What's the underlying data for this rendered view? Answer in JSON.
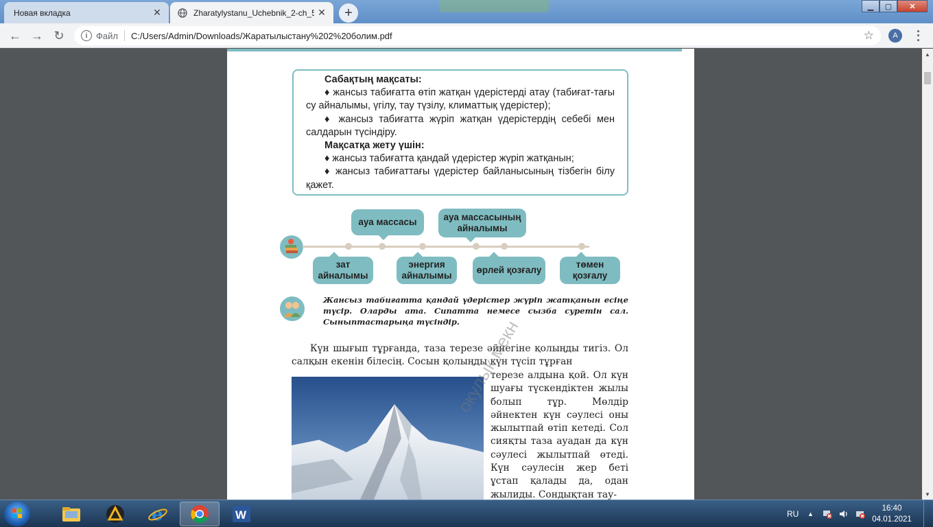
{
  "browser": {
    "tabs": [
      {
        "title": "Новая вкладка",
        "active": false
      },
      {
        "title": "Zharatylystanu_Uchebnik_2-ch_5",
        "active": true
      }
    ],
    "address": {
      "scheme_label": "Файл",
      "url": "C:/Users/Admin/Downloads/Жаратылыстану%202%20болим.pdf"
    },
    "profile_initial": "A"
  },
  "page": {
    "goal_box": {
      "heading1": "Сабақтың мақсаты:",
      "item1": "♦ жансыз табиғатта өтіп жатқан үдерістерді атау (табиғат-тағы су айналымы, үгілу, тау түзілу, климаттық үдерістер);",
      "item2": "♦ жансыз табиғатта жүріп жатқан үдерістердің себебі мен салдарын түсіндіру.",
      "heading2": "Мақсатқа жету үшін:",
      "item3": "♦ жансыз табиғатта қандай үдерістер жүріп жатқанын;",
      "item4": "♦ жансыз табиғаттағы үдерістер байланысының тізбегін білу қажет."
    },
    "timeline": {
      "above": [
        "ауа массасы",
        "ауа массасының айналымы"
      ],
      "below": [
        "зат айналымы",
        "энергия айналымы",
        "өрлей қозғалу",
        "төмен қозғалу"
      ]
    },
    "task": "Жансыз табиғатта қандай үдерістер жүріп жатқанын есіңе түсір. Оларды ата. Сипатта немесе сызба суретін сал. Сыныптастарыңа түсіндір.",
    "body_full": "Күн шығып тұрғанда, таза терезе әйнегіне қолыңды тигіз. Ол салқын екенін білесің. Сосын қолыңды күн түсіп тұрған",
    "body_wrap": "терезе алдына қой. Ол күн шуағы түскендіктен жылы болып тұр. Мөлдір әйнектен күн сәулесі оны жылытпай өтіп кетеді. Сол сияқты таза ауадан да күн сәулесі жылытпай өтеді. Күн сәулесін жер беті ұстап қалады да, одан жылиды. Сондықтан тау-",
    "watermark": "окулык.мекн"
  },
  "taskbar": {
    "language": "RU",
    "time": "16:40",
    "date": "04.01.2021"
  },
  "colors": {
    "accent_teal": "#7fbcc1",
    "timeline": "#d8cdbf"
  }
}
